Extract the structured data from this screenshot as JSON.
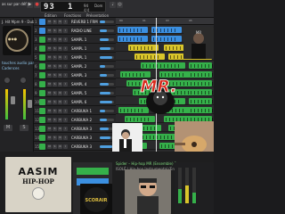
{
  "window": {
    "title": "as sur par défaut",
    "menu": [
      "Édition",
      "Fonctions",
      "Présentation"
    ]
  },
  "lcd": {
    "bar": "93",
    "beat": "1",
    "bpm": "94",
    "key": "Dom",
    "signature": "4/4"
  },
  "library": {
    "header": "J. Hit Mpm 9 - Dubbe",
    "items": [
      "touches audio par défaut",
      "Cadences"
    ]
  },
  "tracks": [
    {
      "num": "1",
      "name": "REVERB 1 FRM",
      "color": "#3b8fe0"
    },
    {
      "num": "2",
      "name": "RADIO LINE",
      "color": "#3b8fe0"
    },
    {
      "num": "3",
      "name": "SAMPL 1",
      "color": "#35b04a"
    },
    {
      "num": "4",
      "name": "SAMPL 1",
      "color": "#35b04a"
    },
    {
      "num": "5",
      "name": "SAMPL 1",
      "color": "#35b04a"
    },
    {
      "num": "6",
      "name": "SAMPL 2",
      "color": "#35b04a"
    },
    {
      "num": "7",
      "name": "SAMPL 3",
      "color": "#35b04a"
    },
    {
      "num": "8",
      "name": "SAMPL 4",
      "color": "#35b04a"
    },
    {
      "num": "9",
      "name": "SAMPL 5",
      "color": "#35b04a"
    },
    {
      "num": "10",
      "name": "SAMPL 6",
      "color": "#35b04a"
    },
    {
      "num": "11",
      "name": "CARBUKA 1",
      "color": "#35b04a"
    },
    {
      "num": "12",
      "name": "CARBUKA 2",
      "color": "#35b04a"
    },
    {
      "num": "13",
      "name": "CARBUKA 3",
      "color": "#35b04a"
    },
    {
      "num": "14",
      "name": "CARBUKA 3",
      "color": "#35b04a"
    },
    {
      "num": "15",
      "name": "CARBUKA 3",
      "color": "#35b04a"
    }
  ],
  "colors": {
    "region_blue": "#3b8fe0",
    "region_green": "#35b04a",
    "region_yellow": "#d9c52a",
    "logo_red": "#d92b1e"
  },
  "logo": {
    "text": "MR."
  },
  "album": {
    "artist": "AASIM",
    "title": "HIP-HOP"
  },
  "video_labels": [
    "Spider – Hip-hop MR (Ensemble) 1",
    "ISOLÉ | Hip-hop Instrumental (Ensemble) 2"
  ],
  "footer_tag": "SCORAIR"
}
